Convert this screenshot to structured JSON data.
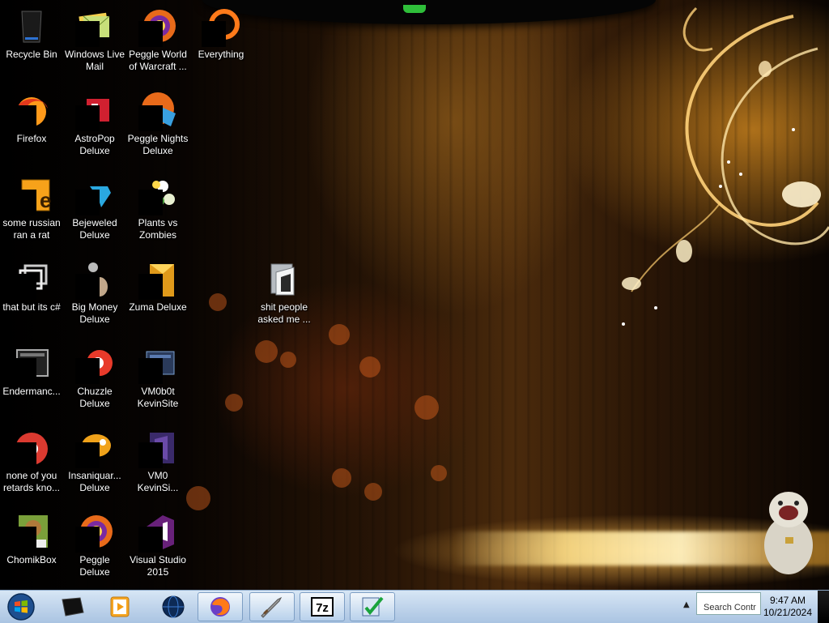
{
  "desktop": {
    "icons": [
      {
        "name": "recycle-bin",
        "label": "Recycle Bin",
        "col": 0,
        "row": 0,
        "icon": "recycle-bin-icon"
      },
      {
        "name": "windows-live-mail",
        "label": "Windows Live Mail",
        "col": 1,
        "row": 0,
        "icon": "mail-icon"
      },
      {
        "name": "peggle-world-of-warcraft",
        "label": "Peggle World of Warcraft ...",
        "col": 2,
        "row": 0,
        "icon": "peggle-icon"
      },
      {
        "name": "everything",
        "label": "Everything",
        "col": 3,
        "row": 0,
        "icon": "search-icon"
      },
      {
        "name": "firefox",
        "label": "Firefox",
        "col": 0,
        "row": 1,
        "icon": "firefox-icon"
      },
      {
        "name": "astropop-deluxe",
        "label": "AstroPop Deluxe",
        "col": 1,
        "row": 1,
        "icon": "astropop-icon"
      },
      {
        "name": "peggle-nights-deluxe",
        "label": "Peggle Nights Deluxe",
        "col": 2,
        "row": 1,
        "icon": "peggle-nights-icon"
      },
      {
        "name": "some-russian-ran-a-rat",
        "label": "some russian ran a rat",
        "col": 0,
        "row": 2,
        "icon": "executable-icon"
      },
      {
        "name": "bejeweled-deluxe",
        "label": "Bejeweled Deluxe",
        "col": 1,
        "row": 2,
        "icon": "gem-icon"
      },
      {
        "name": "plants-vs-zombies",
        "label": "Plants vs Zombies",
        "col": 2,
        "row": 2,
        "icon": "plant-icon"
      },
      {
        "name": "that-but-its-csharp",
        "label": "that but its c#",
        "col": 0,
        "row": 3,
        "icon": "shortcut-icon"
      },
      {
        "name": "big-money-deluxe",
        "label": "Big Money Deluxe",
        "col": 1,
        "row": 3,
        "icon": "money-icon"
      },
      {
        "name": "zuma-deluxe",
        "label": "Zuma Deluxe",
        "col": 2,
        "row": 3,
        "icon": "zuma-icon"
      },
      {
        "name": "shit-people-asked-me",
        "label": "shit people asked me ...",
        "col": "free",
        "row": "free",
        "icon": "folder-icon"
      },
      {
        "name": "endermanch",
        "label": "Endermanc...",
        "col": 0,
        "row": 4,
        "icon": "terminal-icon"
      },
      {
        "name": "chuzzle-deluxe",
        "label": "Chuzzle Deluxe",
        "col": 1,
        "row": 4,
        "icon": "chuzzle-icon"
      },
      {
        "name": "vm0b0t-kevinsite",
        "label": "VM0b0t KevinSite",
        "col": 2,
        "row": 4,
        "icon": "vm-icon"
      },
      {
        "name": "none-of-you-retards-know",
        "label": "none of you retards kno...",
        "col": 0,
        "row": 5,
        "icon": "chrome-icon"
      },
      {
        "name": "insaniquarium-deluxe",
        "label": "Insaniquar... Deluxe",
        "col": 1,
        "row": 5,
        "icon": "fish-icon"
      },
      {
        "name": "vm0-kevinsite",
        "label": "VM0 KevinSi...",
        "col": 2,
        "row": 5,
        "icon": "vs-icon"
      },
      {
        "name": "chomikbox",
        "label": "ChomikBox",
        "col": 0,
        "row": 6,
        "icon": "chomikbox-icon"
      },
      {
        "name": "peggle-deluxe",
        "label": "Peggle Deluxe",
        "col": 1,
        "row": 6,
        "icon": "peggle-icon"
      },
      {
        "name": "visual-studio-2015",
        "label": "Visual Studio 2015",
        "col": 2,
        "row": 6,
        "icon": "visual-studio-icon"
      }
    ]
  },
  "taskbar": {
    "start": {
      "icon": "windows-start-icon"
    },
    "pinned": [
      {
        "name": "taskbar-desktop-manager",
        "icon": "monitor-icon",
        "active": false
      },
      {
        "name": "taskbar-media-player",
        "icon": "media-player-icon",
        "active": false
      },
      {
        "name": "taskbar-globe",
        "icon": "globe-icon",
        "active": false
      },
      {
        "name": "taskbar-firefox",
        "icon": "firefox-icon",
        "active": true
      },
      {
        "name": "taskbar-sword-tool",
        "icon": "sword-icon",
        "active": true
      },
      {
        "name": "taskbar-7zip",
        "icon": "sevenzip-icon",
        "active": true
      },
      {
        "name": "taskbar-checklist",
        "icon": "checklist-icon",
        "active": true
      }
    ],
    "tray": {
      "search_preview": "Search Contr",
      "time": "9:47 AM",
      "date": "10/21/2024"
    }
  },
  "colors": {
    "accent": "#f3a21a",
    "taskbar_top": "#d7e6f5",
    "taskbar_bottom": "#aac4e2"
  }
}
